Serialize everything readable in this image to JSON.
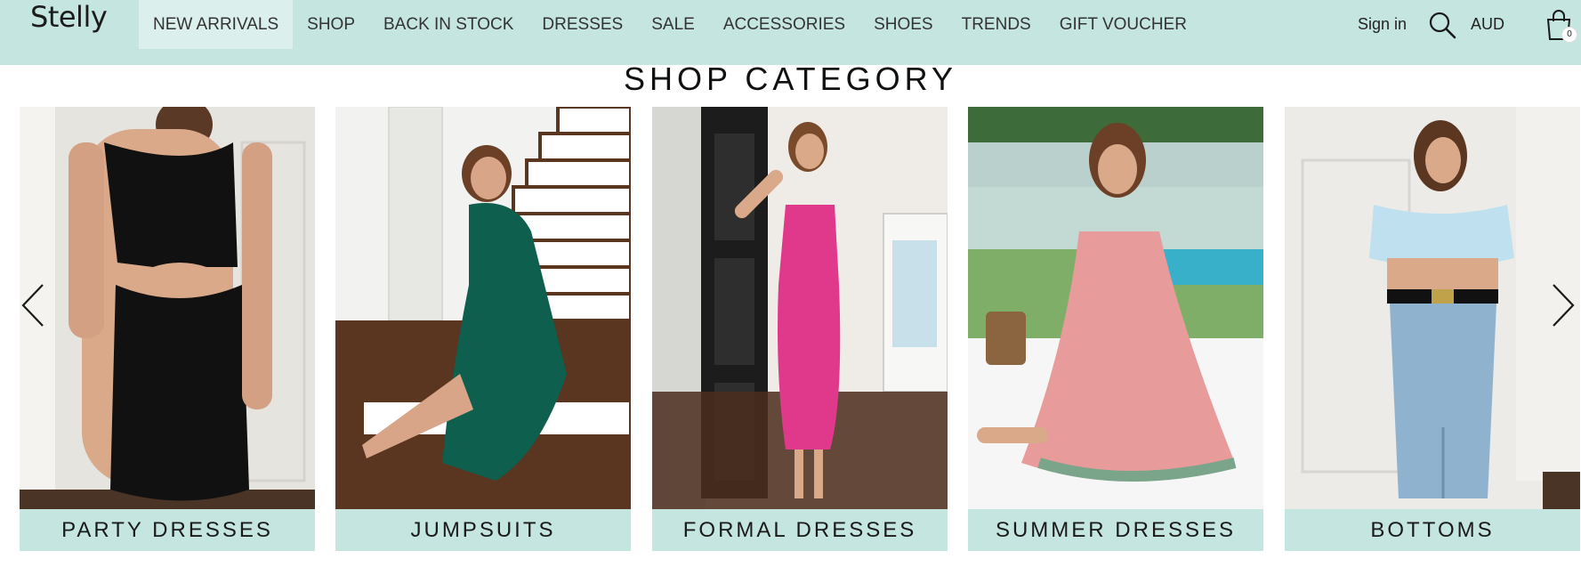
{
  "header": {
    "logo": "Stelly",
    "nav": [
      {
        "label": "NEW ARRIVALS",
        "active": true
      },
      {
        "label": "SHOP"
      },
      {
        "label": "BACK IN STOCK"
      },
      {
        "label": "DRESSES"
      },
      {
        "label": "SALE"
      },
      {
        "label": "ACCESSORIES"
      },
      {
        "label": "SHOES"
      },
      {
        "label": "TRENDS"
      },
      {
        "label": "GIFT VOUCHER"
      }
    ],
    "signin": "Sign in",
    "currency": "AUD",
    "cart_count": "0"
  },
  "section_title": "SHOP CATEGORY",
  "categories": [
    {
      "label": "PARTY DRESSES",
      "bg": "#e6e4df",
      "outfit": "#111111",
      "scene": "white-wall"
    },
    {
      "label": "JUMPSUITS",
      "bg": "#f2f2f0",
      "outfit": "#0f5f4f",
      "scene": "stairs"
    },
    {
      "label": "FORMAL DRESSES",
      "bg": "#efece7",
      "outfit": "#e0398c",
      "scene": "doorway"
    },
    {
      "label": "SUMMER DRESSES",
      "bg": "#7fae68",
      "outfit": "#e79b9b",
      "scene": "garden"
    },
    {
      "label": "BOTTOMS",
      "bg": "#ecebe8",
      "outfit": "#8fb3cf",
      "scene": "white-wall"
    }
  ],
  "colors": {
    "header_bg": "#c5e5e0",
    "nav_active_bg": "#dbefec",
    "label_bg": "#c5e5e0"
  },
  "icons": {
    "search": "search-icon",
    "cart": "shopping-bag-icon",
    "prev": "chevron-left-icon",
    "next": "chevron-right-icon"
  }
}
